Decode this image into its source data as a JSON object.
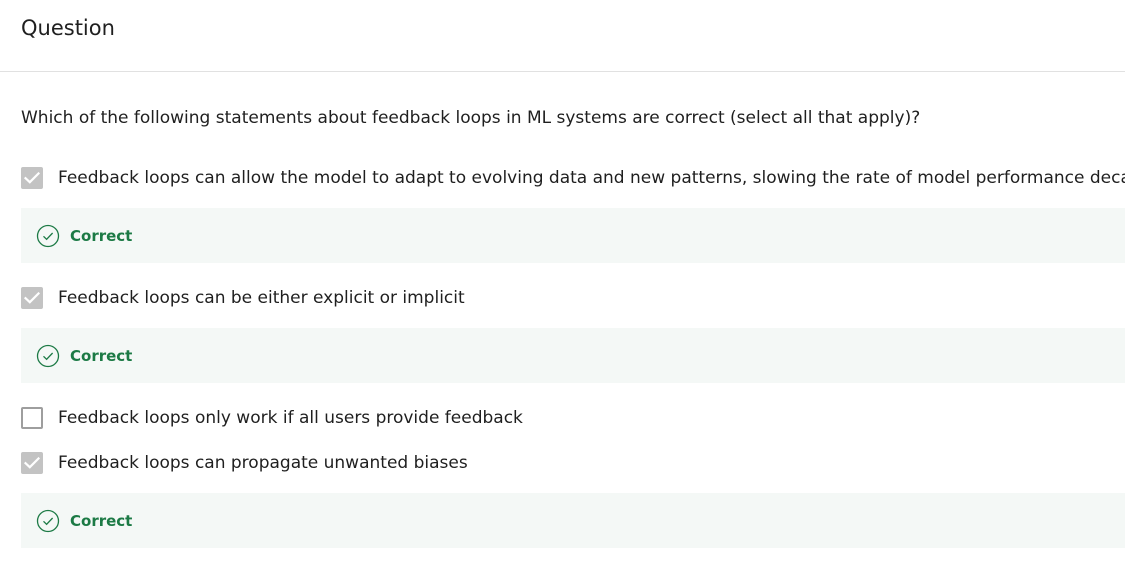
{
  "header": {
    "title": "Question"
  },
  "question": {
    "prompt": "Which of the following statements about feedback loops in ML systems are correct (select all that apply)?"
  },
  "options": [
    {
      "label": "Feedback loops can allow the model to adapt to evolving data and new patterns, slowing the rate of model performance decay",
      "checked": true,
      "feedback": "Correct"
    },
    {
      "label": "Feedback loops can be either explicit or implicit",
      "checked": true,
      "feedback": "Correct"
    },
    {
      "label": "Feedback loops only work if all users provide feedback",
      "checked": false,
      "feedback": ""
    },
    {
      "label": "Feedback loops can propagate unwanted biases",
      "checked": true,
      "feedback": "Correct"
    }
  ],
  "icons": {
    "checkmark": "check-icon",
    "correct": "check-circle-icon"
  },
  "colors": {
    "correct_text": "#1c7a45",
    "correct_bg": "#f4f8f6",
    "checkbox_checked": "#c3c3c3",
    "checkbox_border": "#9e9e9e"
  }
}
